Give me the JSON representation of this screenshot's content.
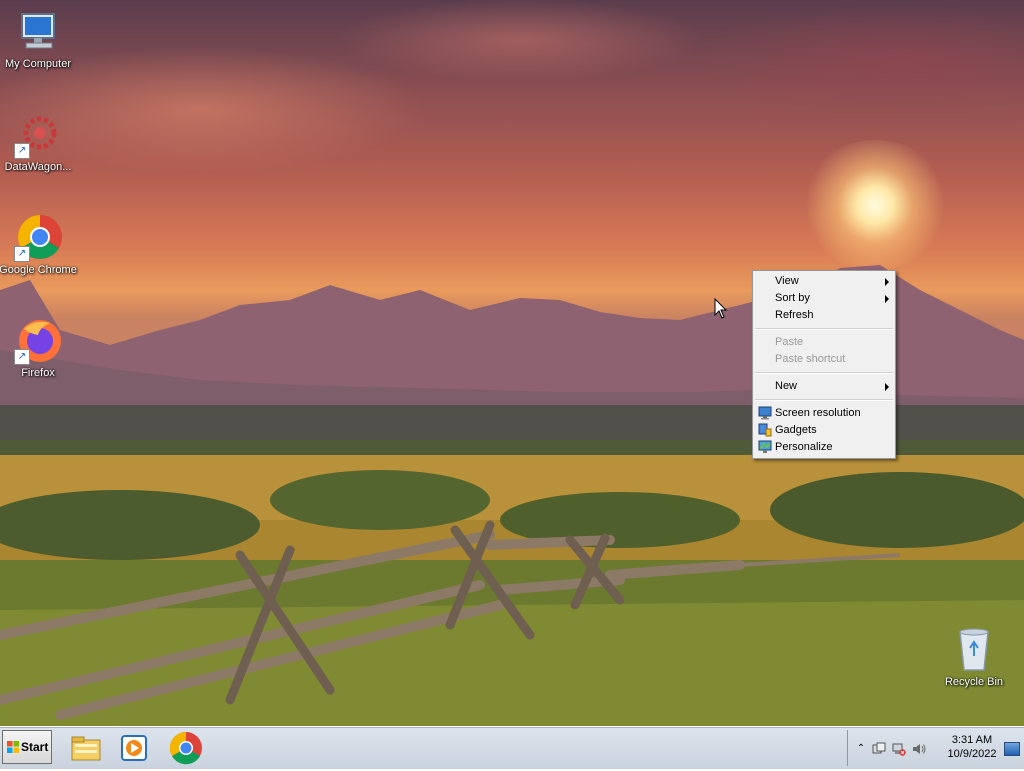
{
  "desktop": {
    "icons": [
      {
        "label": "My Computer",
        "icon": "my-computer-icon"
      },
      {
        "label": "DataWagon...",
        "icon": "datawagon-icon"
      },
      {
        "label": "Google Chrome",
        "icon": "chrome-icon"
      },
      {
        "label": "Firefox",
        "icon": "firefox-icon"
      },
      {
        "label": "Recycle Bin",
        "icon": "recycle-bin-icon"
      }
    ]
  },
  "context_menu": {
    "items": {
      "view": "View",
      "sort_by": "Sort by",
      "refresh": "Refresh",
      "paste": "Paste",
      "paste_shortcut": "Paste shortcut",
      "new": "New",
      "screen_resolution": "Screen resolution",
      "gadgets": "Gadgets",
      "personalize": "Personalize"
    }
  },
  "taskbar": {
    "start_label": "Start",
    "pinned": [
      "explorer-icon",
      "media-player-icon",
      "chrome-icon"
    ],
    "clock": {
      "time": "3:31 AM",
      "date": "10/9/2022"
    }
  },
  "colors": {
    "taskbar": "#c9d3de",
    "menu_background": "#f0f0f0",
    "menu_disabled_text": "#9a9a9a"
  }
}
